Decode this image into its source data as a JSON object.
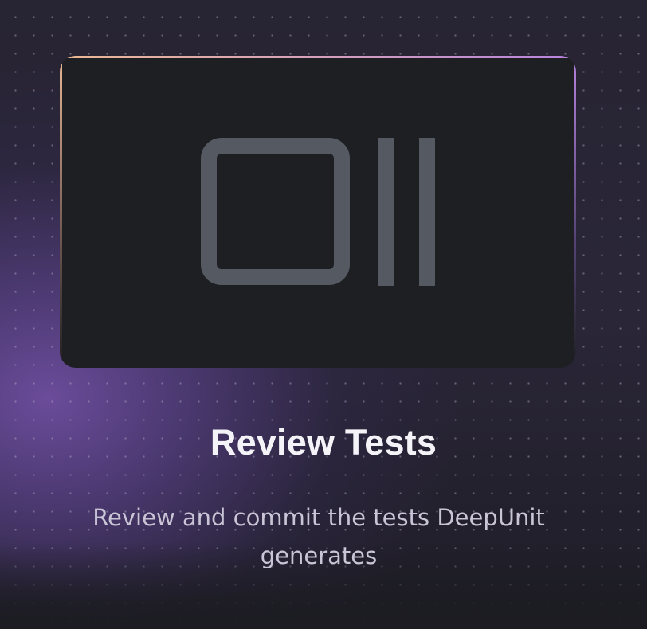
{
  "feature": {
    "icon": "review-panel-icon",
    "title": "Review Tests",
    "description": "Review and commit the tests DeepUnit generates"
  },
  "colors": {
    "background": "#1c1c22",
    "glow": "#6e4ea0",
    "card": "#1e1f23",
    "border_start": "#eab893",
    "border_end": "#b783dd",
    "icon_stroke": "#555a62",
    "title": "#f4f3f8",
    "description": "#c9c5d6"
  }
}
